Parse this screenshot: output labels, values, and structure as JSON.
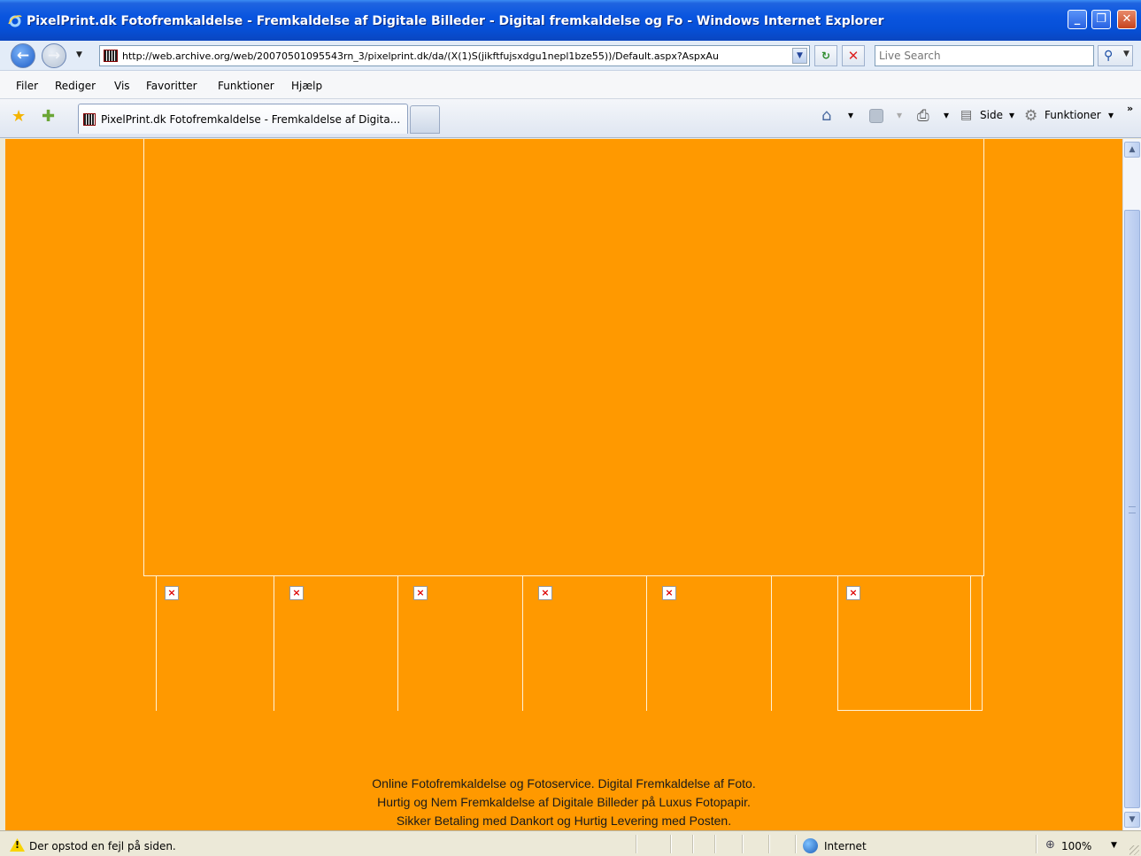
{
  "window": {
    "title": "PixelPrint.dk Fotofremkaldelse - Fremkaldelse af Digitale Billeder - Digital fremkaldelse og Fo - Windows Internet Explorer",
    "controls": [
      "minimize",
      "restore",
      "close"
    ]
  },
  "address_bar": {
    "url": "http://web.archive.org/web/20070501095543rn_3/pixelprint.dk/da/(X(1)S(jikftfujsxdgu1nepl1bze55))/Default.aspx?AspxAu",
    "search_placeholder": "Live Search"
  },
  "menu": {
    "items": [
      "Filer",
      "Rediger",
      "Vis",
      "Favoritter",
      "Funktioner",
      "Hjælp"
    ]
  },
  "tabs": {
    "active_label": "PixelPrint.dk Fotofremkaldelse - Fremkaldelse af Digita...",
    "toolbar": {
      "page_label": "Side",
      "tools_label": "Funktioner"
    }
  },
  "content": {
    "broken_image_glyph": "×",
    "footer_lines": [
      "Online Fotofremkaldelse og Fotoservice. Digital Fremkaldelse af Foto.",
      "Hurtig og Nem Fremkaldelse af Digitale Billeder på Luxus Fotopapir.",
      "Sikker Betaling med Dankort og Hurtig Levering med Posten."
    ],
    "background_color": "#ff9900"
  },
  "status_bar": {
    "message": "Der opstod en fejl på siden.",
    "zone": "Internet",
    "zoom": "100%"
  },
  "colors": {
    "titlebar": "#0a55df",
    "page_bg": "#ff9900",
    "chrome": "#ece9d8"
  },
  "icons": [
    "ie-icon",
    "back-icon",
    "forward-icon",
    "favicon",
    "refresh-icon",
    "stop-icon",
    "search-icon",
    "star-icon",
    "add-favorite-icon",
    "home-icon",
    "feed-icon",
    "print-icon",
    "page-icon",
    "gear-icon",
    "warning-icon",
    "globe-icon",
    "zoom-icon"
  ]
}
